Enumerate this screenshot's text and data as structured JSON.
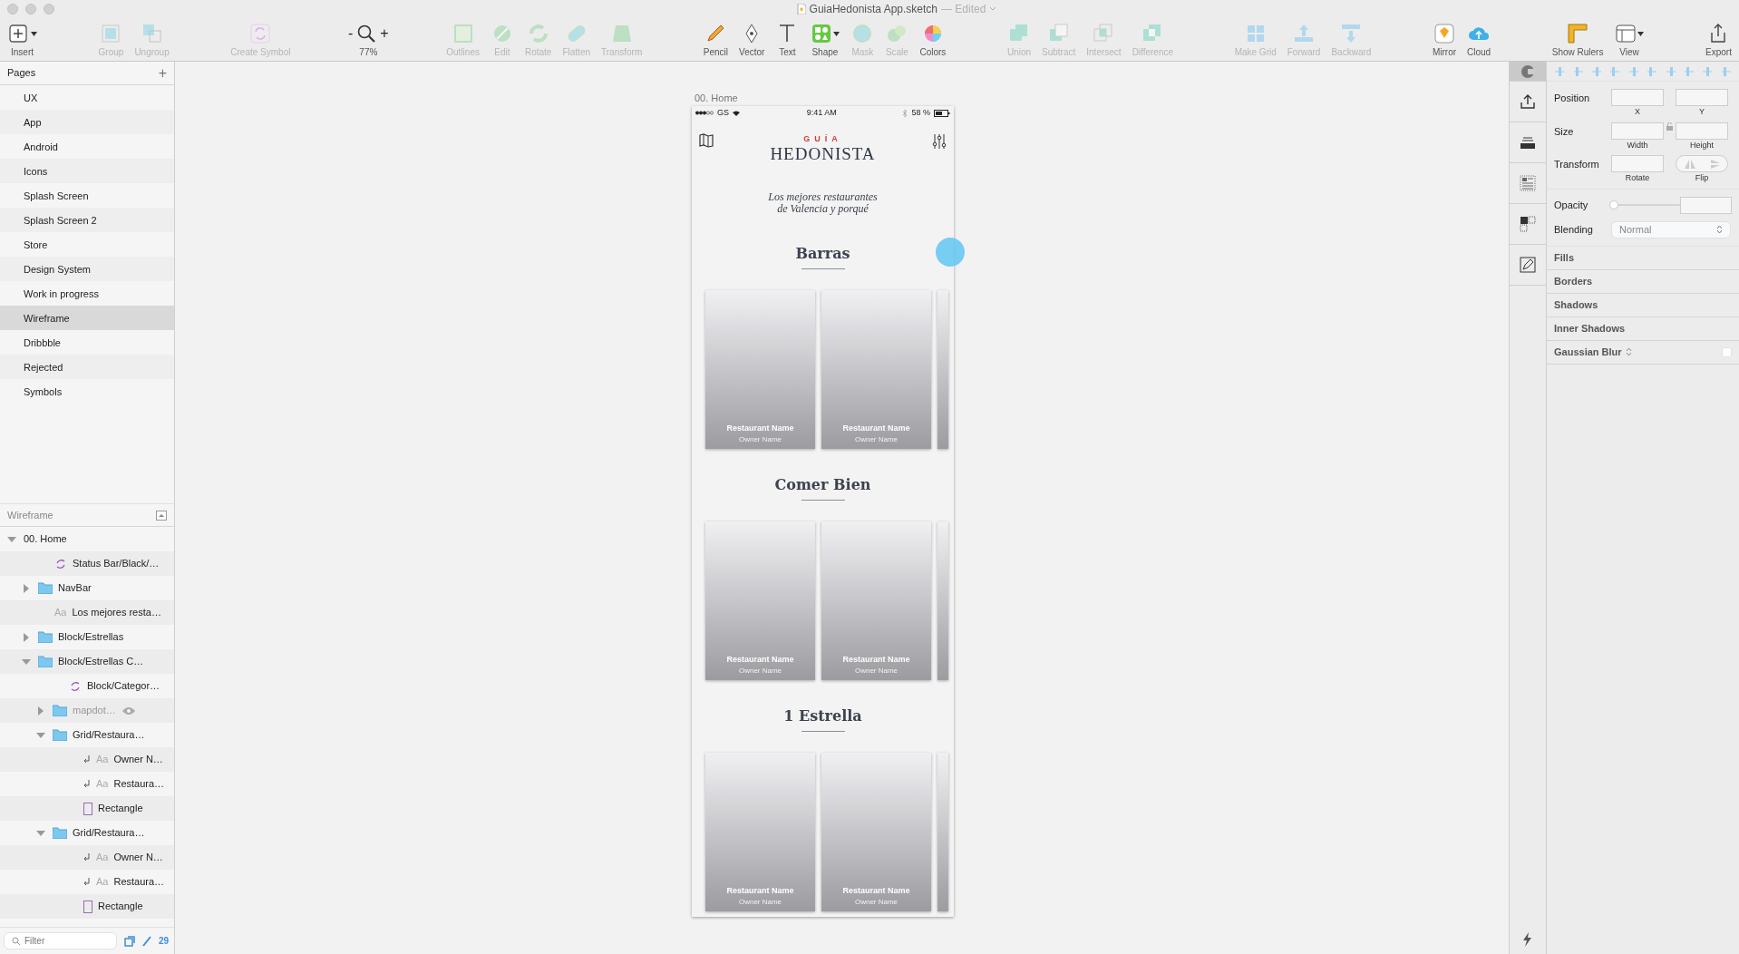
{
  "window": {
    "title": "GuiaHedonista App.sketch",
    "status": "— Edited"
  },
  "toolbar": {
    "groups": [
      [
        {
          "label": "Insert",
          "disabled": false,
          "has_menu": true
        }
      ],
      [
        {
          "label": "Group",
          "disabled": true,
          "has_menu": false
        },
        {
          "label": "Ungroup",
          "disabled": true,
          "has_menu": false
        }
      ],
      [
        {
          "label": "Create Symbol",
          "disabled": true,
          "has_menu": false
        }
      ],
      [
        {
          "label": "Outlines",
          "disabled": true,
          "has_menu": false
        },
        {
          "label": "Edit",
          "disabled": true,
          "has_menu": false
        },
        {
          "label": "Rotate",
          "disabled": true,
          "has_menu": false
        },
        {
          "label": "Flatten",
          "disabled": true,
          "has_menu": false
        },
        {
          "label": "Transform",
          "disabled": true,
          "has_menu": false
        }
      ],
      [
        {
          "label": "Pencil",
          "disabled": false,
          "has_menu": false
        },
        {
          "label": "Vector",
          "disabled": false,
          "has_menu": false
        },
        {
          "label": "Text",
          "disabled": false,
          "has_menu": false
        },
        {
          "label": "Shape",
          "disabled": false,
          "has_menu": true
        },
        {
          "label": "Mask",
          "disabled": true,
          "has_menu": false
        },
        {
          "label": "Scale",
          "disabled": true,
          "has_menu": false
        },
        {
          "label": "Colors",
          "disabled": false,
          "has_menu": false
        }
      ],
      [
        {
          "label": "Union",
          "disabled": true,
          "has_menu": false
        },
        {
          "label": "Subtract",
          "disabled": true,
          "has_menu": false
        },
        {
          "label": "Intersect",
          "disabled": true,
          "has_menu": false
        },
        {
          "label": "Difference",
          "disabled": true,
          "has_menu": false
        }
      ],
      [
        {
          "label": "Make Grid",
          "disabled": true,
          "has_menu": false
        },
        {
          "label": "Forward",
          "disabled": true,
          "has_menu": false
        },
        {
          "label": "Backward",
          "disabled": true,
          "has_menu": false
        }
      ],
      [
        {
          "label": "Mirror",
          "disabled": false,
          "has_menu": false
        },
        {
          "label": "Cloud",
          "disabled": false,
          "has_menu": false
        }
      ],
      [
        {
          "label": "Show Rulers",
          "disabled": false,
          "has_menu": false
        },
        {
          "label": "View",
          "disabled": false,
          "has_menu": true
        }
      ],
      [
        {
          "label": "Export",
          "disabled": false,
          "has_menu": false
        }
      ]
    ],
    "zoom": {
      "minus": "-",
      "plus": "+",
      "level": "77%"
    }
  },
  "pages": {
    "title": "Pages",
    "add": "+",
    "items": [
      {
        "label": "UX",
        "selected": false
      },
      {
        "label": "App",
        "selected": false
      },
      {
        "label": "Android",
        "selected": false
      },
      {
        "label": "Icons",
        "selected": false
      },
      {
        "label": "Splash Screen",
        "selected": false
      },
      {
        "label": "Splash Screen 2",
        "selected": false
      },
      {
        "label": "Store",
        "selected": false
      },
      {
        "label": "Design System",
        "selected": false
      },
      {
        "label": "Work in progress",
        "selected": false
      },
      {
        "label": "Wireframe",
        "selected": true
      },
      {
        "label": "Dribbble",
        "selected": false
      },
      {
        "label": "Rejected",
        "selected": false
      },
      {
        "label": "Symbols",
        "selected": false
      }
    ]
  },
  "layers": {
    "title": "Wireframe",
    "items": [
      {
        "kind": "artboard",
        "label": "00. Home",
        "expanded": true,
        "hidden": false,
        "children": [
          {
            "kind": "symbol",
            "label": "Status Bar/Black/…",
            "hidden": false
          },
          {
            "kind": "group",
            "label": "NavBar",
            "expanded": false,
            "hidden": false
          },
          {
            "kind": "text",
            "glyph": "Aa",
            "label": "Los mejores resta…",
            "hidden": false,
            "clipped": false
          },
          {
            "kind": "group",
            "label": "Block/Estrellas",
            "expanded": false,
            "hidden": false
          },
          {
            "kind": "group",
            "label": "Block/Estrellas C…",
            "expanded": true,
            "hidden": false,
            "children": [
              {
                "kind": "symbol",
                "label": "Block/Categor…",
                "hidden": false
              },
              {
                "kind": "group",
                "label": "mapdot…",
                "expanded": false,
                "hidden": true
              },
              {
                "kind": "group",
                "label": "Grid/Restaura…",
                "expanded": true,
                "hidden": false,
                "children": [
                  {
                    "kind": "text",
                    "glyph": "Aa",
                    "label": "Owner N…",
                    "hidden": false,
                    "clipped": true
                  },
                  {
                    "kind": "text",
                    "glyph": "Aa",
                    "label": "Restaura…",
                    "hidden": false,
                    "clipped": true
                  },
                  {
                    "kind": "shape",
                    "label": "Rectangle",
                    "hidden": false
                  }
                ]
              },
              {
                "kind": "group",
                "label": "Grid/Restaura…",
                "expanded": true,
                "hidden": false,
                "children": [
                  {
                    "kind": "text",
                    "glyph": "Aa",
                    "label": "Owner N…",
                    "hidden": false,
                    "clipped": true
                  },
                  {
                    "kind": "text",
                    "glyph": "Aa",
                    "label": "Restaura…",
                    "hidden": false,
                    "clipped": true
                  },
                  {
                    "kind": "shape",
                    "label": "Rectangle",
                    "hidden": false
                  }
                ]
              }
            ]
          }
        ]
      }
    ],
    "filter": {
      "placeholder": "Filter",
      "count": "29"
    }
  },
  "artboard": {
    "label": "00. Home",
    "status_bar": {
      "carrier": "GS",
      "time": "9:41 AM",
      "battery": "58 %"
    },
    "logo": {
      "top": "GUÍA",
      "main": "HEDONISTA"
    },
    "tagline": [
      "Los mejores restaurantes",
      "de Valencia y porqué"
    ],
    "sections": [
      {
        "title": "Barras",
        "cards": [
          {
            "name": "Restaurant Name",
            "owner": "Owner Name"
          },
          {
            "name": "Restaurant Name",
            "owner": "Owner Name"
          }
        ]
      },
      {
        "title": "Comer Bien",
        "cards": [
          {
            "name": "Restaurant Name",
            "owner": "Owner Name"
          },
          {
            "name": "Restaurant Name",
            "owner": "Owner Name"
          }
        ]
      },
      {
        "title": "1 Estrella",
        "cards": [
          {
            "name": "Restaurant Name",
            "owner": "Owner Name"
          },
          {
            "name": "Restaurant Name",
            "owner": "Owner Name"
          }
        ]
      }
    ]
  },
  "inspector": {
    "rows": [
      {
        "label": "Position",
        "fields": [
          "X",
          "Y"
        ],
        "lock": false
      },
      {
        "label": "Size",
        "fields": [
          "Width",
          "Height"
        ],
        "lock": true
      },
      {
        "label": "Transform",
        "fields": [
          "Rotate",
          "Flip"
        ],
        "lock": false
      }
    ],
    "opacity": {
      "label": "Opacity",
      "level": 0
    },
    "blending": {
      "label": "Blending",
      "value": "Normal"
    },
    "sections": [
      {
        "label": "Fills",
        "toggle": false
      },
      {
        "label": "Borders",
        "toggle": false
      },
      {
        "label": "Shadows",
        "toggle": false
      },
      {
        "label": "Inner Shadows",
        "toggle": false
      },
      {
        "label": "Gaussian Blur",
        "toggle": true,
        "checked": false
      }
    ]
  }
}
